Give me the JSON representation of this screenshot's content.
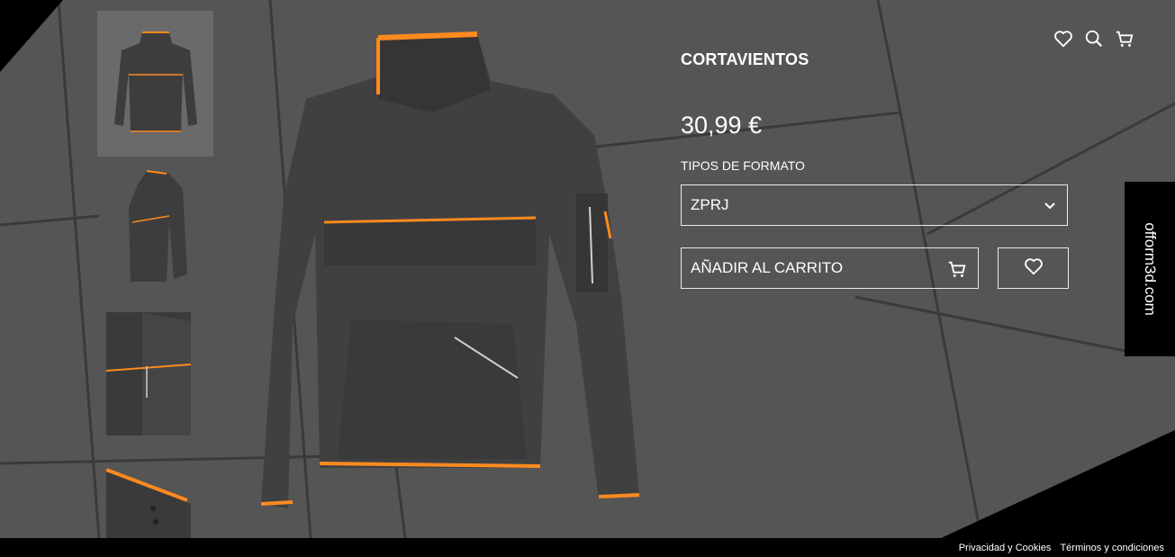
{
  "product": {
    "title": "CORTAVIENTOS",
    "price": "30,99 €",
    "format_label": "TIPOS DE FORMATO",
    "format_selected": "ZPRJ",
    "add_to_cart_label": "AÑADIR AL CARRITO"
  },
  "side_tab": {
    "label": "ofform3d.com"
  },
  "footer": {
    "privacy_label": "Privacidad y Cookies",
    "terms_label": "Términos y condiciones"
  },
  "colors": {
    "background": "#555555",
    "accent": "#ff8a1e",
    "garment": "#3d3d3d",
    "text": "#ffffff"
  },
  "icons": [
    "heart-icon",
    "search-icon",
    "cart-icon",
    "chevron-down-icon"
  ]
}
